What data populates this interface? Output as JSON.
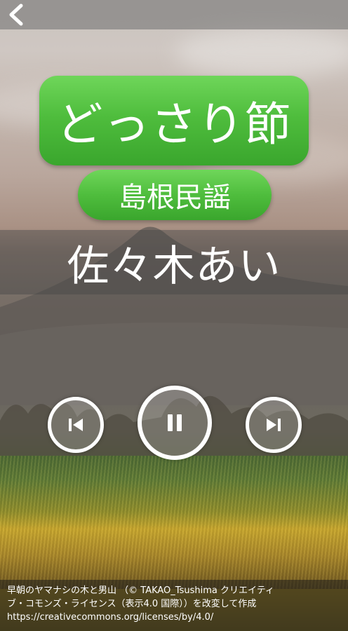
{
  "header": {
    "back_icon": "chevron-left-icon"
  },
  "song": {
    "title": "どっさり節",
    "genre": "島根民謡",
    "singer": "佐々木あい"
  },
  "player": {
    "prev_icon": "skip-previous-icon",
    "pause_icon": "pause-icon",
    "next_icon": "skip-next-icon",
    "state": "playing"
  },
  "credit": {
    "line1": "早朝のヤマナシの木と男山 （© TAKAO_Tsushima クリエイティ",
    "line2": "ブ・コモンズ・ライセンス（表示4.0 国際））を改変して作成",
    "line3": "https://creativecommons.org/licenses/by/4.0/"
  },
  "colors": {
    "pill_green": "#4fbd3d",
    "text": "#ffffff"
  }
}
